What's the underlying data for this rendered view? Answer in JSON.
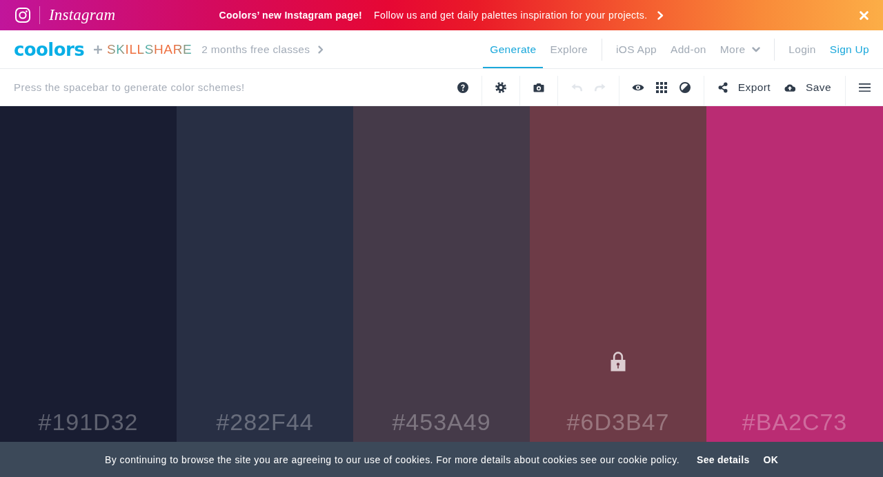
{
  "banner": {
    "brand": "Instagram",
    "headline": "Coolors’ new Instagram page!",
    "message": "Follow us and get daily palettes inspiration for your projects."
  },
  "header": {
    "logo": "coolors",
    "partner": "SKILLSHARE",
    "promo": "2 months free classes",
    "nav": [
      {
        "links": [
          {
            "label": "Generate",
            "kind": "link",
            "selected": true
          },
          {
            "label": "Explore",
            "kind": "link",
            "selected": false
          }
        ]
      },
      {
        "links": [
          {
            "label": "iOS App",
            "kind": "link",
            "selected": false
          },
          {
            "label": "Add-on",
            "kind": "link",
            "selected": false
          },
          {
            "label": "More",
            "kind": "menu",
            "selected": false
          }
        ]
      },
      {
        "links": [
          {
            "label": "Login",
            "kind": "link",
            "selected": false
          },
          {
            "label": "Sign Up",
            "kind": "cta",
            "selected": false
          }
        ]
      }
    ]
  },
  "toolbar": {
    "hint": "Press the spacebar to generate color schemes!",
    "undo": {
      "disabled": true
    },
    "redo": {
      "disabled": true
    },
    "export": {
      "label": "Export"
    },
    "save": {
      "label": "Save"
    }
  },
  "palette": [
    {
      "hex": "#191D32",
      "color": "#191d32",
      "locked": false
    },
    {
      "hex": "#282F44",
      "color": "#282f44",
      "locked": false
    },
    {
      "hex": "#453A49",
      "color": "#453a49",
      "locked": false
    },
    {
      "hex": "#6D3B47",
      "color": "#6d3b47",
      "locked": true
    },
    {
      "hex": "#BA2C73",
      "color": "#ba2c73",
      "locked": false
    }
  ],
  "cookie_bar": {
    "message": "By continuing to browse the site you are agreeing to our use of cookies. For more details about cookies see our cookie policy.",
    "details": "See details",
    "ok": "OK"
  }
}
